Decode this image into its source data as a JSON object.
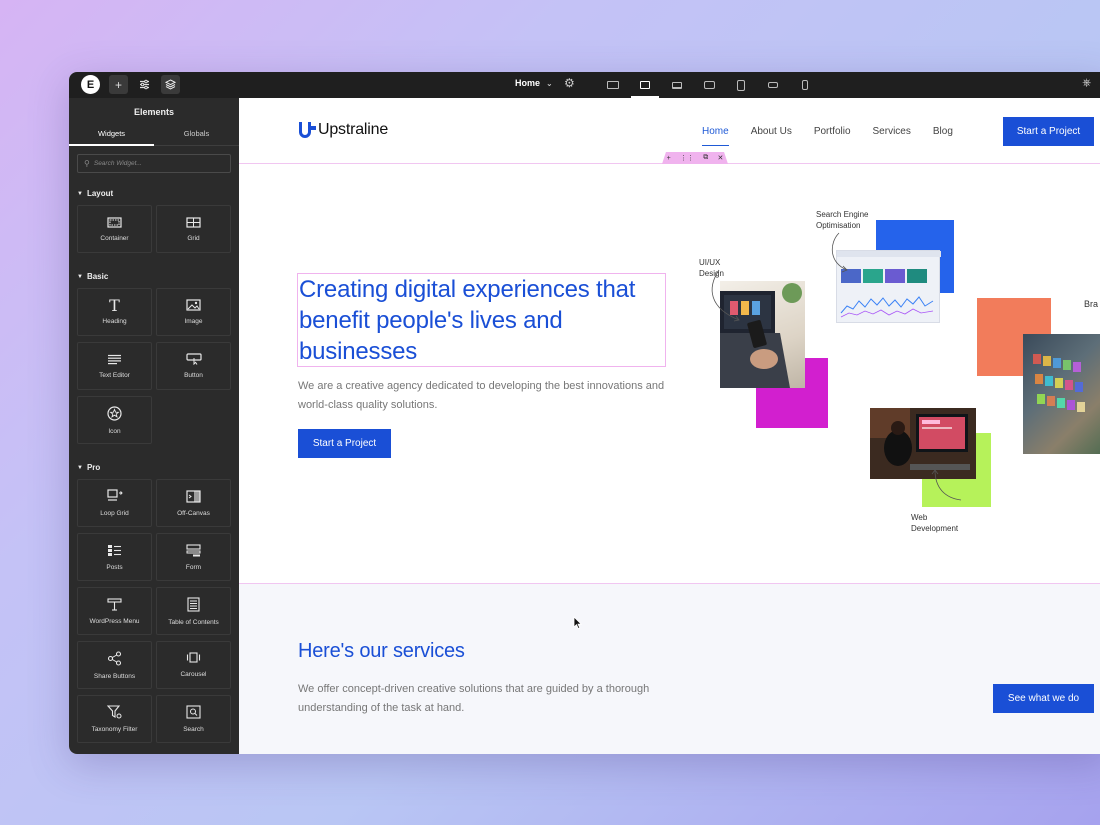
{
  "toolbar": {
    "page_name": "Home",
    "icons": [
      "elementor-logo-icon",
      "add-icon",
      "site-settings-icon",
      "structure-layers-icon",
      "page-settings-gear-icon",
      "publish-icon"
    ],
    "devices": [
      "desktop",
      "widescreen-active",
      "laptop",
      "tablet-landscape",
      "tablet-portrait",
      "mobile-landscape",
      "mobile-portrait"
    ]
  },
  "panel": {
    "title": "Elements",
    "tabs": [
      "Widgets",
      "Globals"
    ],
    "search_placeholder": "Search Widget...",
    "sections": [
      {
        "label": "Layout",
        "widgets": [
          {
            "label": "Container",
            "icon": "container-icon"
          },
          {
            "label": "Grid",
            "icon": "grid-icon"
          }
        ]
      },
      {
        "label": "Basic",
        "widgets": [
          {
            "label": "Heading",
            "icon": "heading-icon"
          },
          {
            "label": "Image",
            "icon": "image-icon"
          },
          {
            "label": "Text Editor",
            "icon": "text-editor-icon"
          },
          {
            "label": "Button",
            "icon": "button-icon"
          },
          {
            "label": "Icon",
            "icon": "star-icon"
          }
        ]
      },
      {
        "label": "Pro",
        "widgets": [
          {
            "label": "Loop Grid",
            "icon": "loop-grid-icon"
          },
          {
            "label": "Off-Canvas",
            "icon": "off-canvas-icon"
          },
          {
            "label": "Posts",
            "icon": "posts-icon"
          },
          {
            "label": "Form",
            "icon": "form-icon"
          },
          {
            "label": "WordPress Menu",
            "icon": "wordpress-menu-icon"
          },
          {
            "label": "Table of Contents",
            "icon": "table-of-contents-icon"
          },
          {
            "label": "Share Buttons",
            "icon": "share-icon"
          },
          {
            "label": "Carousel",
            "icon": "carousel-icon"
          },
          {
            "label": "Taxonomy Filter",
            "icon": "filter-icon"
          },
          {
            "label": "Search",
            "icon": "search-icon"
          }
        ]
      }
    ]
  },
  "site": {
    "brand": "Upstraline",
    "nav": [
      "Home",
      "About Us",
      "Portfolio",
      "Services",
      "Blog"
    ],
    "nav_active": "Home",
    "cta": "Start a Project",
    "hero": {
      "title": "Creating digital experiences that benefit people's lives and businesses",
      "text": "We are a creative agency dedicated to developing the best innovations and world-class quality solutions.",
      "button": "Start a Project"
    },
    "art_labels": {
      "uiux": "UI/UX\nDesign",
      "seo": "Search Engine\nOptimisation",
      "web": "Web\nDevelopment",
      "brand": "Bra"
    },
    "services": {
      "title": "Here's our services",
      "text": "We offer concept-driven creative solutions that are guided by a thorough understanding of the task at hand.",
      "button": "See what we do"
    }
  },
  "colors": {
    "accent": "#1a4fd6",
    "selection": "#f0b3ee",
    "panel_bg": "#2b2b2b",
    "topbar_bg": "#1f1f1f"
  }
}
